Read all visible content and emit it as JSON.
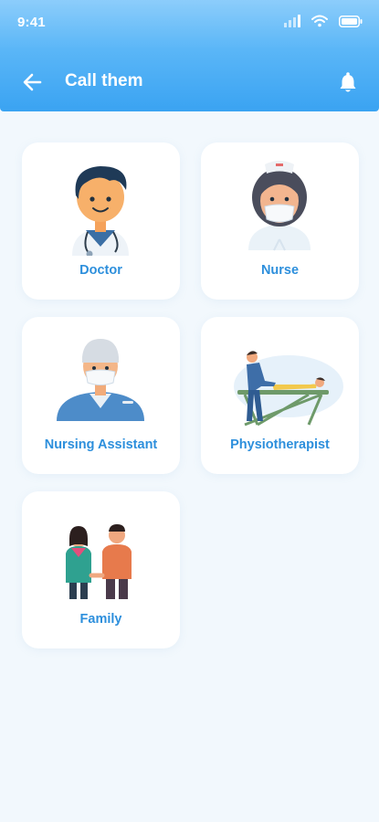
{
  "status_bar": {
    "time": "9:41",
    "icons": [
      "signal-icon",
      "wifi-icon",
      "battery-icon"
    ]
  },
  "app_bar": {
    "title": "Call them",
    "back_icon": "arrow-left-icon",
    "action_icon": "bell-icon"
  },
  "contacts": [
    {
      "label": "Doctor",
      "icon": "doctor-illustration"
    },
    {
      "label": "Nurse",
      "icon": "nurse-illustration"
    },
    {
      "label": "Nursing Assistant",
      "icon": "nursing-assistant-illustration"
    },
    {
      "label": "Physiotherapist",
      "icon": "physiotherapist-illustration"
    },
    {
      "label": "Family",
      "icon": "family-illustration"
    }
  ],
  "colors": {
    "header_gradient_top": "#8ccdfb",
    "header_gradient_bottom": "#3aa3f2",
    "background": "#f2f8fd",
    "label": "#2d8fdc",
    "card": "#ffffff"
  }
}
